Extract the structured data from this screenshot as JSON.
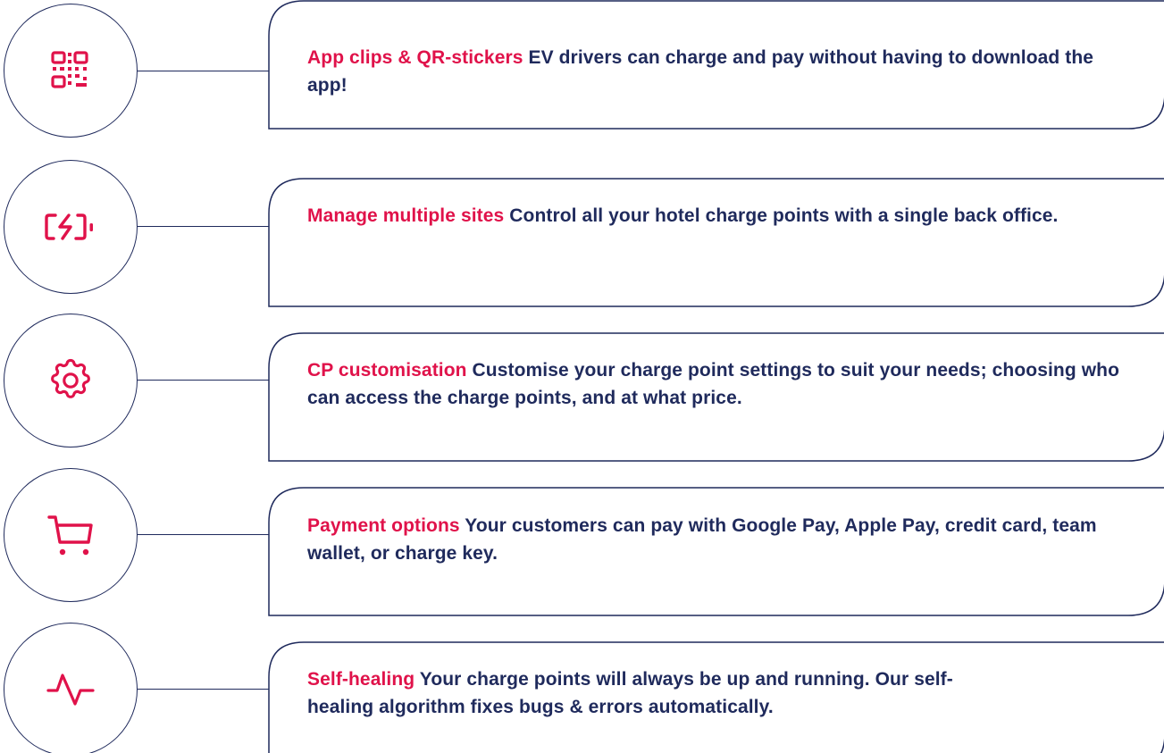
{
  "colors": {
    "accent": "#e0124a",
    "navy": "#1f2a5c"
  },
  "features": [
    {
      "icon": "qr-code-icon",
      "title": "App clips & QR-stickers",
      "description": "EV drivers can charge and pay without having to download the app!"
    },
    {
      "icon": "battery-charging-icon",
      "title": "Manage multiple sites",
      "description": "Control all your hotel charge points with a single back office."
    },
    {
      "icon": "gear-icon",
      "title": "CP customisation",
      "description": "Customise your charge point settings to suit your needs; choosing who can access the charge points, and at what price."
    },
    {
      "icon": "shopping-cart-icon",
      "title": "Payment options",
      "description": "Your customers can pay with Google Pay, Apple Pay, credit card, team wallet, or charge key."
    },
    {
      "icon": "activity-pulse-icon",
      "title": "Self-healing",
      "description": "Your charge points will always be up and running. Our self-healing algorithm fixes bugs & errors automatically."
    }
  ]
}
